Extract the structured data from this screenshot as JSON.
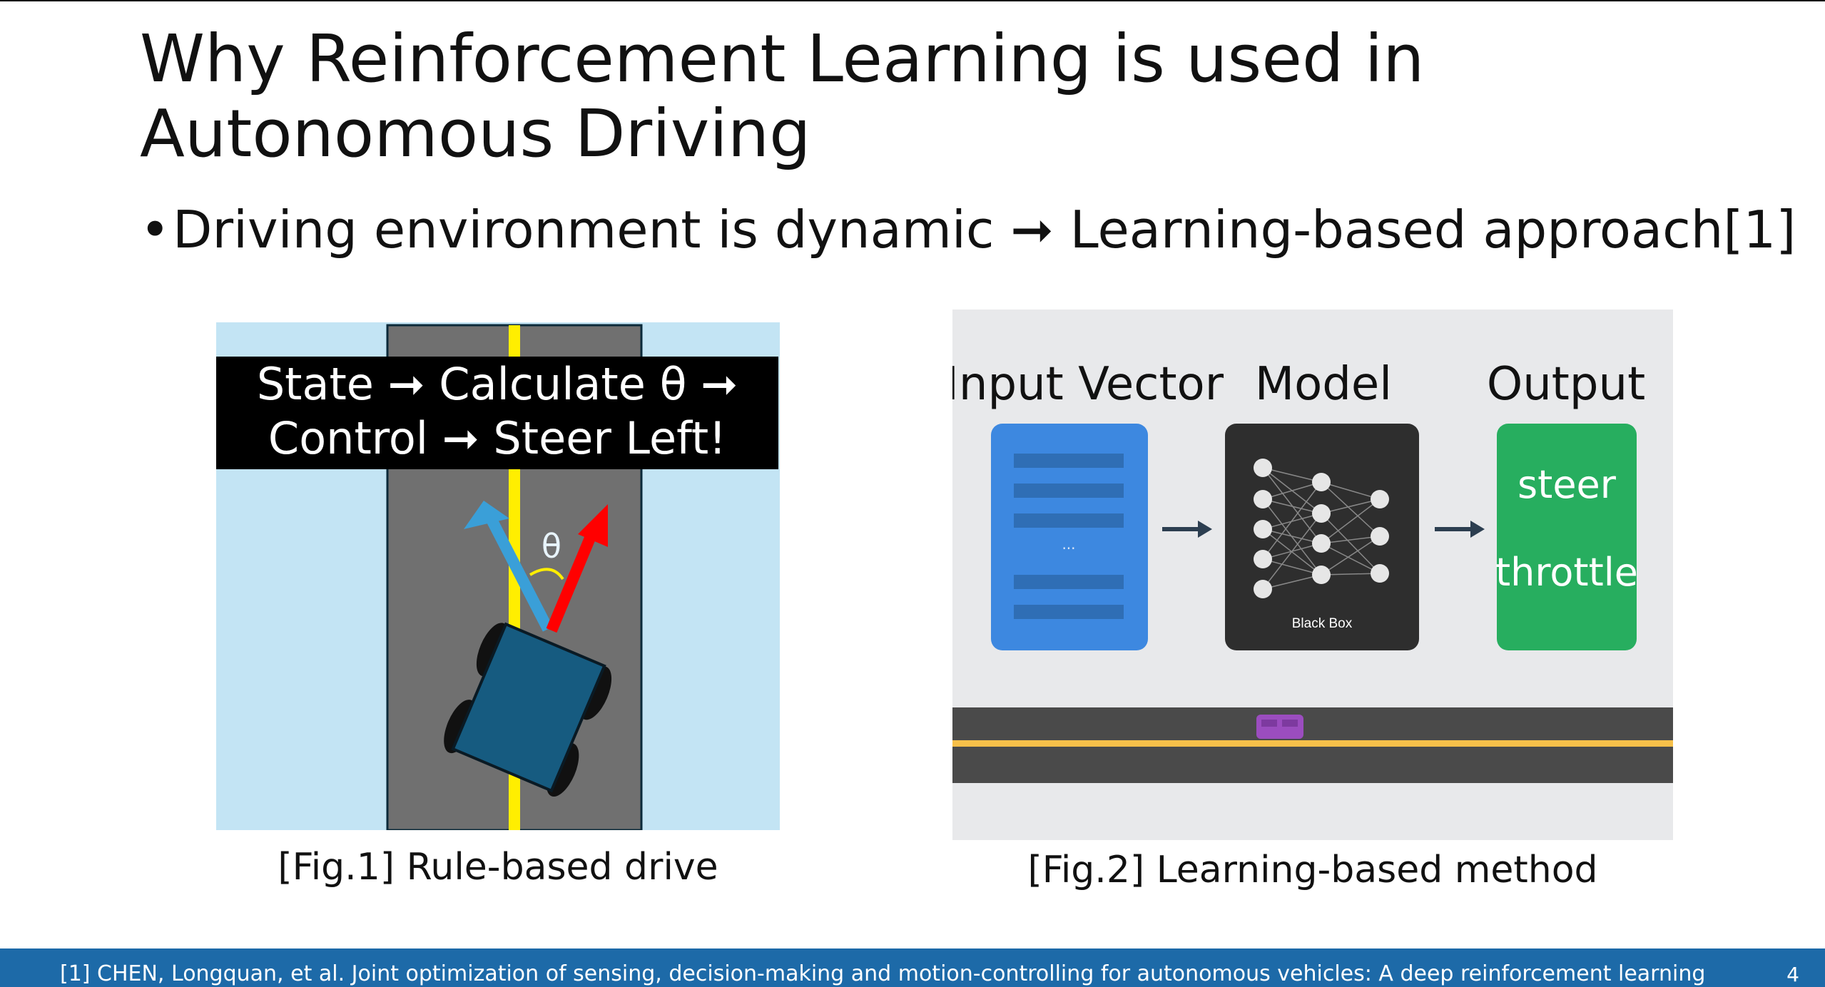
{
  "slide": {
    "title_line1": "Why Reinforcement Learning is used in",
    "title_line2": "Autonomous Driving",
    "bullet": "Driving environment is dynamic ➞ Learning-based approach[1]"
  },
  "fig1": {
    "state_line1": "State ➞  Calculate θ ➞",
    "state_line2": "Control ➞  Steer Left!",
    "theta": "θ",
    "caption": "[Fig.1] Rule-based drive",
    "colors": {
      "sky": "#c3e4f4",
      "road": "#707070",
      "center_line": "#ffee00",
      "car": "#165b80",
      "blue_arrow": "#3a9fd8",
      "red_arrow": "#ff0000"
    }
  },
  "fig2": {
    "input_label": "Input Vector",
    "model_label": "Model",
    "output_label": "Output",
    "ellipsis": "...",
    "black_box": "Black Box",
    "steer": "steer",
    "throttle": "throttle",
    "caption": "[Fig.2] Learning-based method",
    "colors": {
      "background": "#e8e9eb",
      "input": "#3d88e0",
      "model": "#2e2e2e",
      "output": "#27ae5f",
      "road": "#4a4a4a",
      "lane": "#f7c04a",
      "car": "#9b4dbf"
    }
  },
  "footer": {
    "citation": "[1] CHEN, Longquan, et al. Joint optimization of sensing, decision-making and motion-controlling for autonomous vehicles: A deep reinforcement learning",
    "page": "4"
  }
}
